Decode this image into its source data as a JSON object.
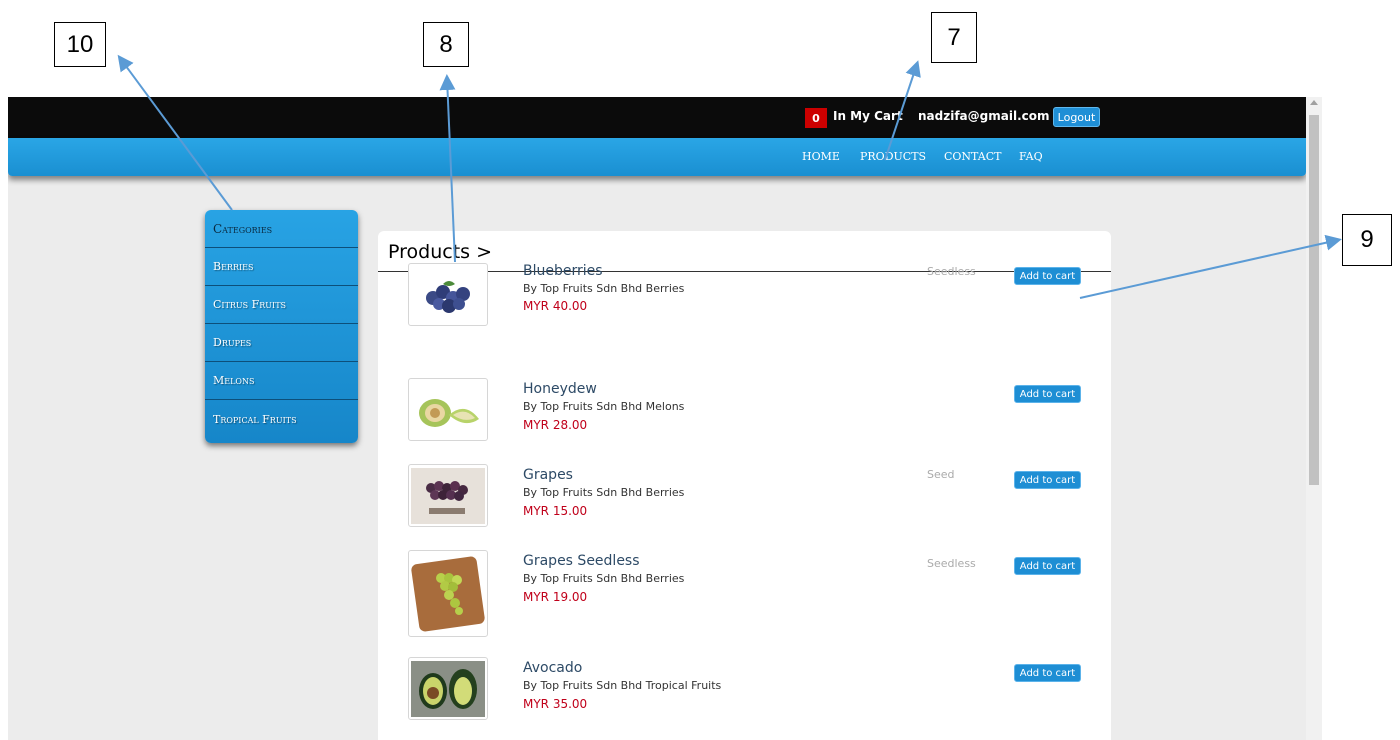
{
  "callouts": [
    "10",
    "8",
    "7",
    "9"
  ],
  "cart": {
    "count": "0",
    "label": "In My Cart"
  },
  "user": {
    "email": "nadzifa@gmail.com",
    "logout_label": "Logout"
  },
  "nav": [
    "HOME",
    "PRODUCTS",
    "CONTACT",
    "FAQ"
  ],
  "categories": {
    "header": "Categories",
    "items": [
      "Berries",
      "Citrus Fruits",
      "Drupes",
      "Melons",
      "Tropical Fruits"
    ]
  },
  "products_title": "Products >",
  "products": [
    {
      "name": "Blueberries",
      "by": "By Top Fruits Sdn Bhd Berries",
      "price": "MYR 40.00",
      "variant": "Seedless",
      "button": "Add to cart",
      "image": "blueberries-image"
    },
    {
      "name": "Honeydew",
      "by": "By Top Fruits Sdn Bhd Melons",
      "price": "MYR 28.00",
      "variant": "",
      "button": "Add to cart",
      "image": "honeydew-image"
    },
    {
      "name": "Grapes",
      "by": "By Top Fruits Sdn Bhd Berries",
      "price": "MYR 15.00",
      "variant": "Seed",
      "button": "Add to cart",
      "image": "grapes-image"
    },
    {
      "name": "Grapes Seedless",
      "by": "By Top Fruits Sdn Bhd Berries",
      "price": "MYR 19.00",
      "variant": "Seedless",
      "button": "Add to cart",
      "image": "green-grapes-image"
    },
    {
      "name": "Avocado",
      "by": "By Top Fruits Sdn Bhd Tropical Fruits",
      "price": "MYR 35.00",
      "variant": "",
      "button": "Add to cart",
      "image": "avocado-image"
    }
  ],
  "colors": {
    "topbar": "#0b0b0b",
    "navbar": "#1e9ad9",
    "price": "#c0001a",
    "cart_badge": "#cc0000"
  }
}
